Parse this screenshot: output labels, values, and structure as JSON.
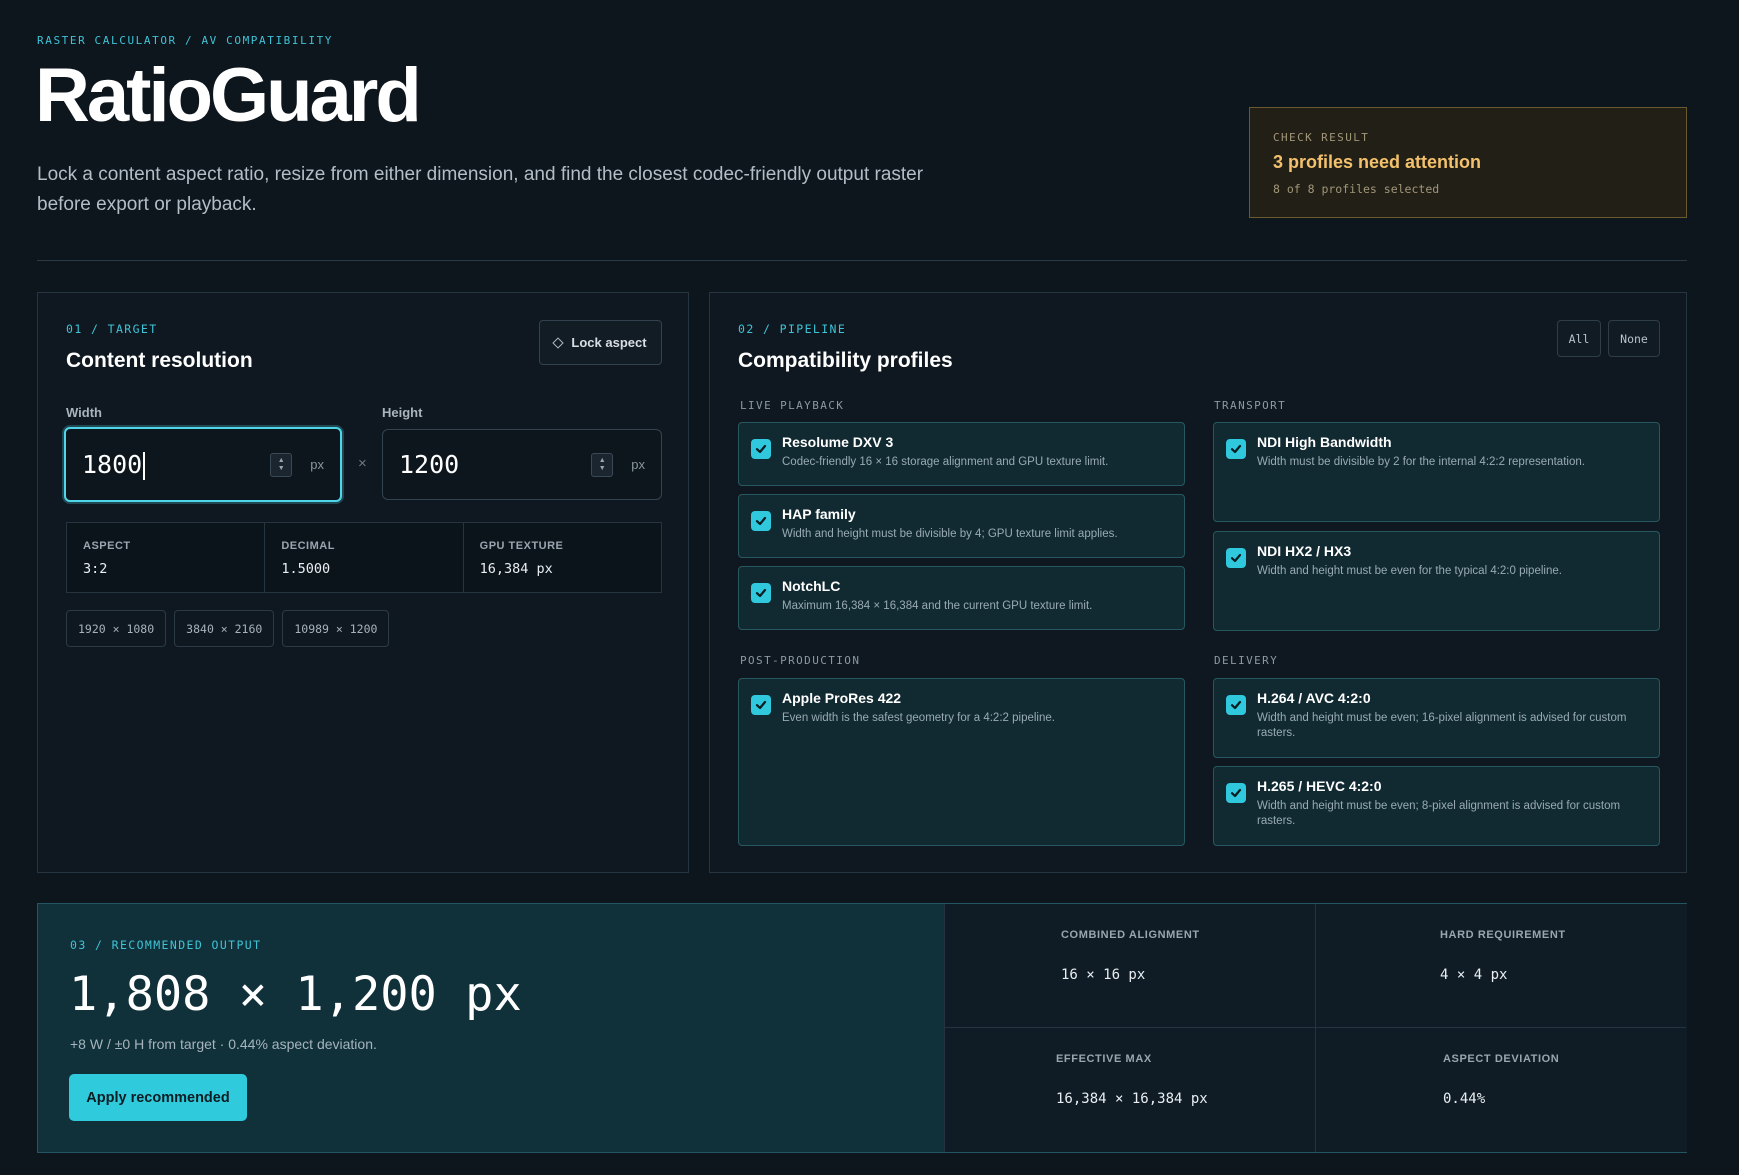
{
  "header": {
    "breadcrumb": "RASTER CALCULATOR / AV COMPATIBILITY",
    "title": "RatioGuard",
    "subtitle": "Lock a content aspect ratio, resize from either dimension, and find the closest codec-friendly output raster before export or playback."
  },
  "check_result": {
    "kicker": "CHECK RESULT",
    "title": "3 profiles need attention",
    "sub": "8 of 8 profiles selected",
    "accent": "#f3c16c"
  },
  "target": {
    "kicker": "01 / TARGET",
    "title": "Content resolution",
    "lock_label": "Lock aspect",
    "width_label": "Width",
    "width_value": "1800",
    "height_label": "Height",
    "height_value": "1200",
    "unit": "px",
    "times": "×",
    "stats": [
      {
        "label": "ASPECT",
        "value": "3:2"
      },
      {
        "label": "DECIMAL",
        "value": "1.5000"
      },
      {
        "label": "GPU TEXTURE",
        "value": "16,384 px"
      }
    ],
    "presets": [
      "1920 × 1080",
      "3840 × 2160",
      "10989 × 1200"
    ]
  },
  "pipeline": {
    "kicker": "02 / PIPELINE",
    "title": "Compatibility profiles",
    "all_label": "All",
    "none_label": "None",
    "groups": {
      "live": "LIVE PLAYBACK",
      "transport": "TRANSPORT",
      "post": "POST-PRODUCTION",
      "delivery": "DELIVERY"
    },
    "profiles": {
      "dxv": {
        "name": "Resolume DXV 3",
        "desc": "Codec-friendly 16 × 16 storage alignment and GPU texture limit."
      },
      "hap": {
        "name": "HAP family",
        "desc": "Width and height must be divisible by 4; GPU texture limit applies."
      },
      "notch": {
        "name": "NotchLC",
        "desc": "Maximum 16,384 × 16,384 and the current GPU texture limit."
      },
      "ndi_hb": {
        "name": "NDI High Bandwidth",
        "desc": "Width must be divisible by 2 for the internal 4:2:2 representation."
      },
      "ndi_hx": {
        "name": "NDI HX2 / HX3",
        "desc": "Width and height must be even for the typical 4:2:0 pipeline."
      },
      "prores": {
        "name": "Apple ProRes 422",
        "desc": "Even width is the safest geometry for a 4:2:2 pipeline."
      },
      "h264": {
        "name": "H.264 / AVC 4:2:0",
        "desc": "Width and height must be even; 16-pixel alignment is advised for custom rasters."
      },
      "h265": {
        "name": "H.265 / HEVC 4:2:0",
        "desc": "Width and height must be even; 8-pixel alignment is advised for custom rasters."
      }
    }
  },
  "output": {
    "kicker": "03 / RECOMMENDED OUTPUT",
    "value": "1,808 × 1,200 px",
    "note": "+8 W / ±0 H from target · 0.44% aspect deviation.",
    "apply_label": "Apply recommended",
    "metrics": {
      "combined": {
        "label": "COMBINED ALIGNMENT",
        "value": "16 × 16 px"
      },
      "hard": {
        "label": "HARD REQUIREMENT",
        "value": "4 × 4 px"
      },
      "max": {
        "label": "EFFECTIVE MAX",
        "value": "16,384 × 16,384 px"
      },
      "deviation": {
        "label": "ASPECT DEVIATION",
        "value": "0.44%"
      }
    }
  }
}
